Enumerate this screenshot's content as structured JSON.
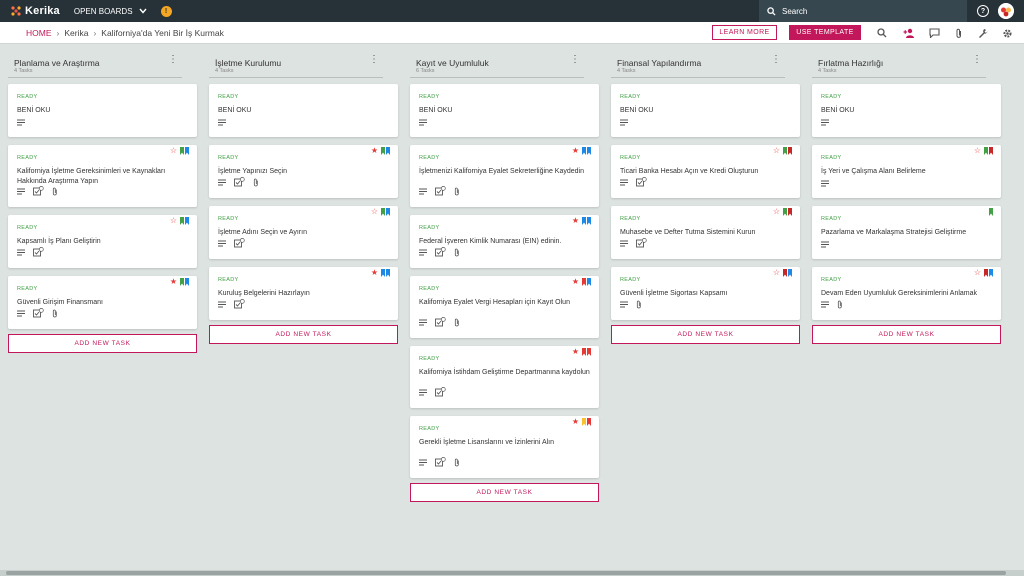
{
  "app": {
    "name": "Kerika",
    "open_boards": "OPEN BOARDS",
    "search_placeholder": "Search",
    "help": "?",
    "bulb": "!"
  },
  "breadcrumb": {
    "home": "HOME",
    "org": "Kerika",
    "board": "Kaliforniya'da Yeni Bir İş Kurmak"
  },
  "actions": {
    "learn_more": "LEARN MORE",
    "use_template": "USE TEMPLATE"
  },
  "colors": {
    "accent": "#c2185b",
    "topbar": "#263238",
    "ready": "#43a047",
    "star": "#e53935"
  },
  "add_task_label": "ADD NEW TASK",
  "columns": [
    {
      "title": "Planlama ve Araştırma",
      "count": "4 Tasks",
      "cards": [
        {
          "status": "READY",
          "title": "BENİ OKU",
          "star": "",
          "flags": [],
          "icons": [
            "notes"
          ]
        },
        {
          "status": "READY",
          "title": "Kaliforniya İşletme Gereksinimleri ve Kaynakları Hakkında Araştırma Yapın",
          "star": "outline",
          "flags": [
            "#43a047",
            "#1e88e5"
          ],
          "icons": [
            "notes",
            "checklist",
            "attach"
          ]
        },
        {
          "status": "READY",
          "title": "Kapsamlı İş Planı Geliştirin",
          "star": "outline",
          "flags": [
            "#43a047",
            "#1e88e5"
          ],
          "icons": [
            "notes",
            "checklist"
          ]
        },
        {
          "status": "READY",
          "title": "Güvenli Girişim Finansmanı",
          "star": "filled",
          "flags": [
            "#43a047",
            "#1e88e5"
          ],
          "icons": [
            "notes",
            "checklist",
            "attach"
          ]
        }
      ]
    },
    {
      "title": "İşletme Kurulumu",
      "count": "4 Tasks",
      "cards": [
        {
          "status": "READY",
          "title": "BENİ OKU",
          "star": "",
          "flags": [],
          "icons": [
            "notes"
          ]
        },
        {
          "status": "READY",
          "title": "İşletme Yapınızı Seçin",
          "star": "filled",
          "flags": [
            "#43a047",
            "#1e88e5"
          ],
          "icons": [
            "notes",
            "checklist",
            "attach"
          ]
        },
        {
          "status": "READY",
          "title": "İşletme Adını Seçin ve Ayırın",
          "star": "outline",
          "flags": [
            "#43a047",
            "#1e88e5"
          ],
          "icons": [
            "notes",
            "checklist"
          ]
        },
        {
          "status": "READY",
          "title": "Kuruluş Belgelerini Hazırlayın",
          "star": "filled",
          "flags": [
            "#1e88e5",
            "#1e88e5"
          ],
          "icons": [
            "notes",
            "checklist"
          ]
        }
      ]
    },
    {
      "title": "Kayıt ve Uyumluluk",
      "count": "6 Tasks",
      "cards": [
        {
          "status": "READY",
          "title": "BENİ OKU",
          "star": "",
          "flags": [],
          "icons": [
            "notes"
          ]
        },
        {
          "status": "READY",
          "title": "İşletmenizi Kaliforniya Eyalet Sekreterliğine Kaydedin",
          "star": "filled",
          "flags": [
            "#1e88e5",
            "#1e88e5"
          ],
          "icons": [
            "notes",
            "checklist",
            "attach"
          ]
        },
        {
          "status": "READY",
          "title": "Federal İşveren Kimlik Numarası (EIN) edinin.",
          "star": "filled",
          "flags": [
            "#1e88e5",
            "#1e88e5"
          ],
          "icons": [
            "notes",
            "checklist",
            "attach"
          ]
        },
        {
          "status": "READY",
          "title": "Kaliforniya Eyalet Vergi Hesapları için Kayıt Olun",
          "star": "filled",
          "flags": [
            "#e53935",
            "#1e88e5"
          ],
          "icons": [
            "notes",
            "checklist",
            "attach"
          ]
        },
        {
          "status": "READY",
          "title": "Kaliforniya İstihdam Geliştirme Departmanına kaydolun",
          "star": "filled",
          "flags": [
            "#e53935",
            "#e53935"
          ],
          "icons": [
            "notes",
            "checklist"
          ]
        },
        {
          "status": "READY",
          "title": "Gerekli İşletme Lisanslarını ve İzinlerini Alın",
          "star": "filled",
          "flags": [
            "#fbc02d",
            "#e53935"
          ],
          "icons": [
            "notes",
            "checklist",
            "attach"
          ]
        }
      ]
    },
    {
      "title": "Finansal Yapılandırma",
      "count": "4 Tasks",
      "cards": [
        {
          "status": "READY",
          "title": "BENİ OKU",
          "star": "",
          "flags": [],
          "icons": [
            "notes"
          ]
        },
        {
          "status": "READY",
          "title": "Ticari Banka Hesabı Açın ve Kredi Oluşturun",
          "star": "outline",
          "flags": [
            "#43a047",
            "#c62828"
          ],
          "icons": [
            "notes",
            "checklist"
          ]
        },
        {
          "status": "READY",
          "title": "Muhasebe ve Defter Tutma Sistemini Kurun",
          "star": "outline",
          "flags": [
            "#43a047",
            "#c62828"
          ],
          "icons": [
            "notes",
            "checklist"
          ]
        },
        {
          "status": "READY",
          "title": "Güvenli İşletme Sigortası Kapsamı",
          "star": "outline",
          "flags": [
            "#c62828",
            "#1e88e5"
          ],
          "icons": [
            "notes",
            "attach"
          ]
        }
      ]
    },
    {
      "title": "Fırlatma Hazırlığı",
      "count": "4 Tasks",
      "cards": [
        {
          "status": "READY",
          "title": "BENİ OKU",
          "star": "",
          "flags": [],
          "icons": [
            "notes"
          ]
        },
        {
          "status": "READY",
          "title": "İş Yeri ve Çalışma Alanı Belirleme",
          "star": "outline",
          "flags": [
            "#43a047",
            "#c62828"
          ],
          "icons": [
            "notes"
          ]
        },
        {
          "status": "READY",
          "title": "Pazarlama ve Markalaşma Stratejisi Geliştirme",
          "star": "",
          "flags": [
            "#43a047"
          ],
          "icons": [
            "notes"
          ]
        },
        {
          "status": "READY",
          "title": "Devam Eden Uyumluluk Gereksinimlerini Anlamak",
          "star": "outline",
          "flags": [
            "#c62828",
            "#1e88e5"
          ],
          "icons": [
            "notes",
            "attach"
          ]
        }
      ]
    }
  ]
}
